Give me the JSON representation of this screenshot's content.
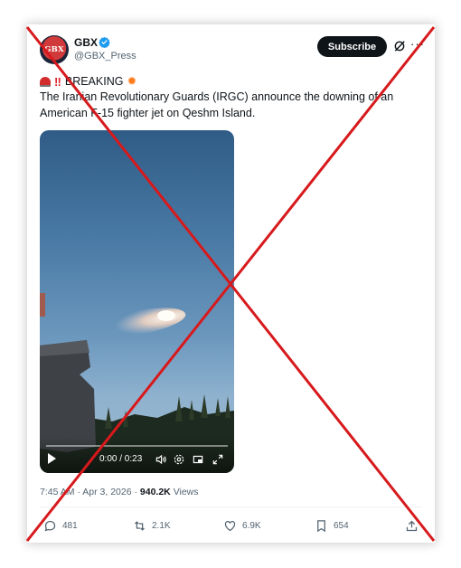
{
  "tweet": {
    "author_name": "GBX",
    "author_handle": "@GBX_Press",
    "avatar_text": "GBX",
    "subscribe_label": "Subscribe",
    "more_label": "···",
    "breaking_label": "BREAKING",
    "body": "The Iranian Revolutionary Guards (IRGC) announce the downing of an American F-15 fighter jet on Qeshm Island.",
    "video": {
      "time": "0:00 / 0:23",
      "progress": 0
    },
    "timestamp": "7:45 AM · Apr 3, 2026 ·",
    "views_count": "940.2K",
    "views_label": "Views",
    "actions": {
      "replies": "481",
      "reposts": "2.1K",
      "likes": "6.9K",
      "bookmarks": "654"
    }
  },
  "overlay": {
    "cross_color": "#d7191c"
  },
  "colors": {
    "accent": "#1d9bf0",
    "text": "#0f1419",
    "muted": "#536471"
  },
  "icons": [
    "verified-badge-icon",
    "grok-icon",
    "more-icon",
    "siren-icon",
    "exclamation-icon",
    "collision-icon",
    "play-icon",
    "volume-icon",
    "settings-icon",
    "pip-icon",
    "fullscreen-icon",
    "reply-icon",
    "repost-icon",
    "like-icon",
    "bookmark-icon",
    "share-icon"
  ]
}
